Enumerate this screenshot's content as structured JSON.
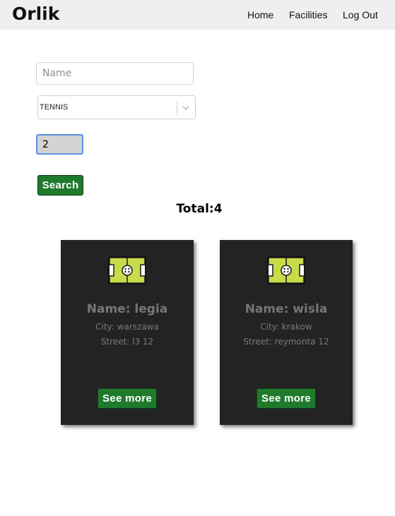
{
  "nav": {
    "brand": "Orlik",
    "links": [
      "Home",
      "Facilities",
      "Log Out"
    ]
  },
  "search": {
    "name_placeholder": "Name",
    "name_value": "",
    "sport_selected": "TENNIS",
    "number_value": "2",
    "button_label": "Search"
  },
  "results": {
    "total_text": "Total:4",
    "cards": [
      {
        "name": "Name: legia",
        "city": "City: warszawa",
        "street": "Street: l3 12",
        "button_label": "See more"
      },
      {
        "name": "Name: wisla",
        "city": "City: krakow",
        "street": "Street: reymonta 12",
        "button_label": "See more"
      }
    ]
  },
  "colors": {
    "navbar_bg": "#efefef",
    "button_green": "#1f7a2c",
    "card_bg": "#232323",
    "field_icon_green": "#c8dc4a"
  },
  "icons": {
    "field": "soccer-field-icon",
    "dropdown": "chevron-down-icon"
  }
}
